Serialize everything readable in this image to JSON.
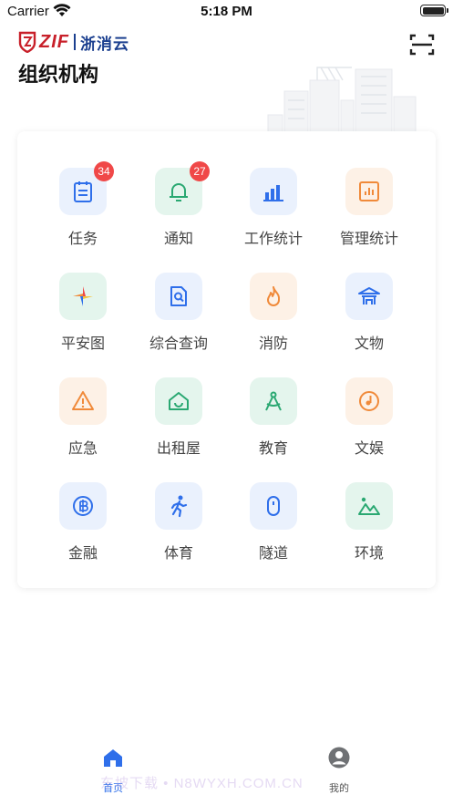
{
  "status_bar": {
    "carrier": "Carrier",
    "time": "5:18 PM"
  },
  "logo": {
    "brand_letters": "ZIF",
    "brand_cn": "浙消云"
  },
  "header": {
    "title": "组织机构"
  },
  "grid": {
    "items": [
      {
        "label": "任务",
        "icon": "clipboard-icon",
        "badge": "34"
      },
      {
        "label": "通知",
        "icon": "bell-icon",
        "badge": "27"
      },
      {
        "label": "工作统计",
        "icon": "bar-chart-icon"
      },
      {
        "label": "管理统计",
        "icon": "stats-board-icon"
      },
      {
        "label": "平安图",
        "icon": "pinwheel-icon"
      },
      {
        "label": "综合查询",
        "icon": "document-search-icon"
      },
      {
        "label": "消防",
        "icon": "flame-icon"
      },
      {
        "label": "文物",
        "icon": "pavilion-icon"
      },
      {
        "label": "应急",
        "icon": "warning-icon"
      },
      {
        "label": "出租屋",
        "icon": "house-icon"
      },
      {
        "label": "教育",
        "icon": "compass-icon"
      },
      {
        "label": "文娱",
        "icon": "music-disc-icon"
      },
      {
        "label": "金融",
        "icon": "coin-icon"
      },
      {
        "label": "体育",
        "icon": "runner-icon"
      },
      {
        "label": "隧道",
        "icon": "tunnel-icon"
      },
      {
        "label": "环境",
        "icon": "mountain-icon"
      }
    ]
  },
  "tab_bar": {
    "home_label": "首页",
    "mine_label": "我的"
  },
  "watermark": "东坡下载 • N8WYXH.COM.CN",
  "colors": {
    "accent_blue": "#2f6fea",
    "green": "#2aa872",
    "orange": "#f08a3a",
    "badge_red": "#f04848",
    "brand_red": "#c8202a",
    "brand_navy": "#1b3f8f"
  }
}
